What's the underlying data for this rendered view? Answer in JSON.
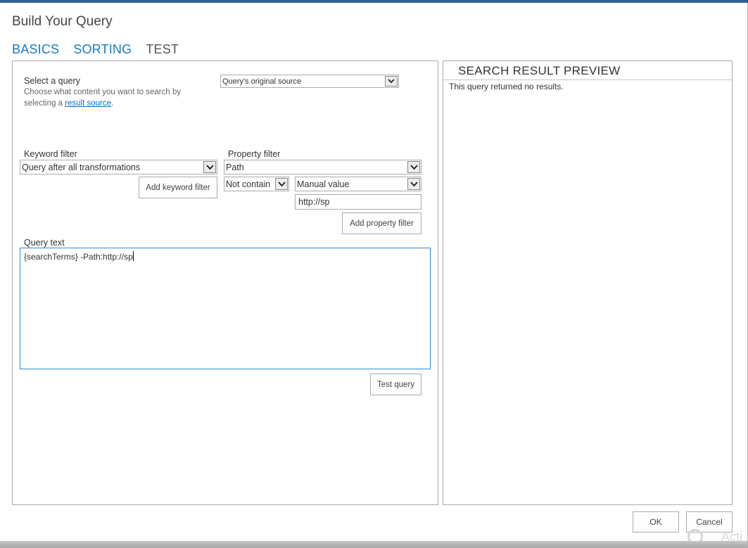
{
  "dialog": {
    "title": "Build Your Query",
    "accent_color": "#1b79bf",
    "topbar_color": "#2f6092"
  },
  "tabs": [
    {
      "label": "BASICS",
      "active": true
    },
    {
      "label": "SORTING",
      "active": true
    },
    {
      "label": "TEST",
      "active": false
    }
  ],
  "basics": {
    "select_query": {
      "label": "Select a query",
      "description_prefix": "Choose what content you want to search by selecting a ",
      "description_link": "result source",
      "description_suffix": ".",
      "value": "Query's original source"
    },
    "keyword_filter": {
      "label": "Keyword filter",
      "value": "Query after all transformations",
      "add_button": "Add keyword filter"
    },
    "property_filter": {
      "label": "Property filter",
      "property": "Path",
      "operator": "Not contain",
      "value_source": "Manual value",
      "value": "http://sp",
      "add_button": "Add property filter"
    },
    "query_text": {
      "label": "Query text",
      "value": "{searchTerms} -Path:http://sp"
    },
    "test_button": "Test query"
  },
  "preview": {
    "title": "SEARCH RESULT PREVIEW",
    "message": "This query returned no results."
  },
  "footer": {
    "ok": "OK",
    "cancel": "Cancel"
  },
  "watermark": {
    "text": "Acti"
  }
}
